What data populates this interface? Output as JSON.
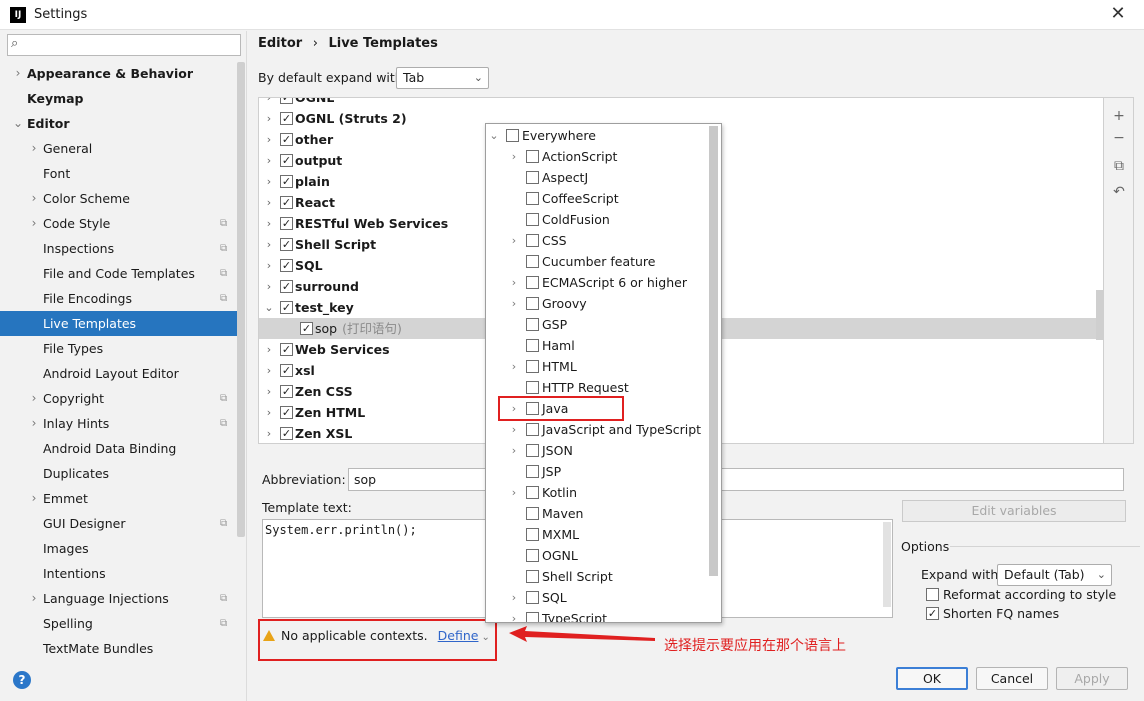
{
  "window": {
    "title": "Settings",
    "app_icon_text": "IJ"
  },
  "sidebar": {
    "search_placeholder": "",
    "items": [
      {
        "label": "Appearance & Behavior",
        "bold": true,
        "arrow": true,
        "indent": 0
      },
      {
        "label": "Keymap",
        "bold": true,
        "arrow": false,
        "indent": 0
      },
      {
        "label": "Editor",
        "bold": true,
        "arrow": "open",
        "indent": 0
      },
      {
        "label": "General",
        "arrow": true,
        "indent": 1
      },
      {
        "label": "Font",
        "indent": 1
      },
      {
        "label": "Color Scheme",
        "arrow": true,
        "indent": 1
      },
      {
        "label": "Code Style",
        "arrow": true,
        "indent": 1,
        "cfg": true
      },
      {
        "label": "Inspections",
        "indent": 1,
        "cfg": true
      },
      {
        "label": "File and Code Templates",
        "indent": 1,
        "cfg": true
      },
      {
        "label": "File Encodings",
        "indent": 1,
        "cfg": true
      },
      {
        "label": "Live Templates",
        "indent": 1,
        "selected": true
      },
      {
        "label": "File Types",
        "indent": 1
      },
      {
        "label": "Android Layout Editor",
        "indent": 1
      },
      {
        "label": "Copyright",
        "arrow": true,
        "indent": 1,
        "cfg": true
      },
      {
        "label": "Inlay Hints",
        "arrow": true,
        "indent": 1,
        "cfg": true
      },
      {
        "label": "Android Data Binding",
        "indent": 1
      },
      {
        "label": "Duplicates",
        "indent": 1
      },
      {
        "label": "Emmet",
        "arrow": true,
        "indent": 1
      },
      {
        "label": "GUI Designer",
        "indent": 1,
        "cfg": true
      },
      {
        "label": "Images",
        "indent": 1
      },
      {
        "label": "Intentions",
        "indent": 1
      },
      {
        "label": "Language Injections",
        "arrow": true,
        "indent": 1,
        "cfg": true
      },
      {
        "label": "Spelling",
        "indent": 1,
        "cfg": true
      },
      {
        "label": "TextMate Bundles",
        "indent": 1
      }
    ]
  },
  "breadcrumb": {
    "parent": "Editor",
    "separator": "›",
    "current": "Live Templates"
  },
  "expand": {
    "label": "By default expand with",
    "value": "Tab"
  },
  "templates": [
    {
      "name": "OGNL",
      "checked": true,
      "arrow": true,
      "partial": true
    },
    {
      "name": "OGNL (Struts 2)",
      "checked": true,
      "arrow": true
    },
    {
      "name": "other",
      "checked": true,
      "arrow": true
    },
    {
      "name": "output",
      "checked": true,
      "arrow": true
    },
    {
      "name": "plain",
      "checked": true,
      "arrow": true
    },
    {
      "name": "React",
      "checked": true,
      "arrow": true
    },
    {
      "name": "RESTful Web Services",
      "checked": true,
      "arrow": true
    },
    {
      "name": "Shell Script",
      "checked": true,
      "arrow": true
    },
    {
      "name": "SQL",
      "checked": true,
      "arrow": true
    },
    {
      "name": "surround",
      "checked": true,
      "arrow": true
    },
    {
      "name": "test_key",
      "checked": true,
      "arrow": "open"
    },
    {
      "name": "sop",
      "hint": "(打印语句)",
      "checked": true,
      "child": true,
      "selected": true
    },
    {
      "name": "Web Services",
      "checked": true,
      "arrow": true
    },
    {
      "name": "xsl",
      "checked": true,
      "arrow": true
    },
    {
      "name": "Zen CSS",
      "checked": true,
      "arrow": true
    },
    {
      "name": "Zen HTML",
      "checked": true,
      "arrow": true
    },
    {
      "name": "Zen XSL",
      "checked": true,
      "arrow": true
    }
  ],
  "toolbar_icons": [
    "add-icon",
    "remove-icon",
    "copy-icon",
    "revert-icon"
  ],
  "toolbar_glyphs": [
    "+",
    "−",
    "⧉",
    "↶"
  ],
  "abbreviation": {
    "label": "Abbreviation:",
    "value": "sop"
  },
  "template_text": {
    "label": "Template text:",
    "value": "System.err.println();"
  },
  "edit_variables_label": "Edit variables",
  "options": {
    "title": "Options",
    "expand_with_label": "Expand with",
    "expand_with_value": "Default (Tab)",
    "reformat_label": "Reformat according to style",
    "reformat_checked": false,
    "shorten_label": "Shorten FQ names",
    "shorten_checked": true
  },
  "context_warning": {
    "text": "No applicable contexts.",
    "link": "Define"
  },
  "annotation": "选择提示要应用在那个语言上",
  "contexts_popup": [
    {
      "label": "Everywhere",
      "arrow": "open",
      "indent": 0
    },
    {
      "label": "ActionScript",
      "arrow": true
    },
    {
      "label": "AspectJ"
    },
    {
      "label": "CoffeeScript"
    },
    {
      "label": "ColdFusion"
    },
    {
      "label": "CSS",
      "arrow": true
    },
    {
      "label": "Cucumber feature"
    },
    {
      "label": "ECMAScript 6 or higher",
      "arrow": true
    },
    {
      "label": "Groovy",
      "arrow": true
    },
    {
      "label": "GSP"
    },
    {
      "label": "Haml"
    },
    {
      "label": "HTML",
      "arrow": true
    },
    {
      "label": "HTTP Request"
    },
    {
      "label": "Java",
      "arrow": true,
      "highlight": true
    },
    {
      "label": "JavaScript and TypeScript",
      "arrow": true
    },
    {
      "label": "JSON",
      "arrow": true
    },
    {
      "label": "JSP"
    },
    {
      "label": "Kotlin",
      "arrow": true
    },
    {
      "label": "Maven"
    },
    {
      "label": "MXML"
    },
    {
      "label": "OGNL"
    },
    {
      "label": "Shell Script"
    },
    {
      "label": "SQL",
      "arrow": true
    },
    {
      "label": "TypeScript",
      "arrow": true
    }
  ],
  "buttons": {
    "ok": "OK",
    "cancel": "Cancel",
    "apply": "Apply"
  },
  "colors": {
    "accent": "#2675bf",
    "highlight_red": "#e02020",
    "link": "#2f65ca",
    "warning": "#e8a317"
  }
}
